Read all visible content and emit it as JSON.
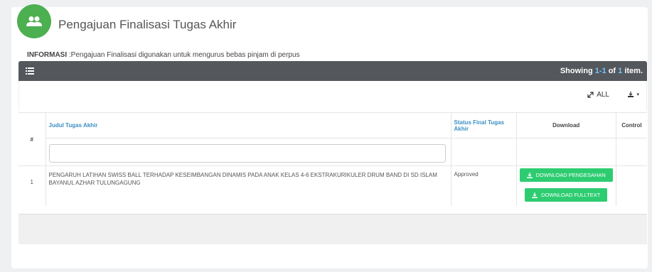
{
  "header": {
    "title": "Pengajuan Finalisasi Tugas Akhir",
    "icon": "users-icon"
  },
  "info": {
    "label": "INFORMASI",
    "text": " :Pengajuan Finalisasi digunakan untuk mengurus bebas pinjam di perpus"
  },
  "toolbar": {
    "showing_prefix": "Showing ",
    "range": "1-1",
    "of": " of ",
    "total": "1",
    "suffix": " item."
  },
  "subbar": {
    "all_label": "ALL"
  },
  "table": {
    "headers": {
      "num": "#",
      "judul": "Judul Tugas Akhir",
      "status": "Status Final Tugas Akhir",
      "download": "Download",
      "control": "Control"
    },
    "rows": [
      {
        "num": "1",
        "judul": "PENGARUH LATIHAN SWISS BALL TERHADAP KESEIMBANGAN DINAMIS PADA ANAK KELAS 4-6 EKSTRAKURIKULER DRUM BAND DI SD ISLAM BAYANUL AZHAR TULUNGAGUNG",
        "status": "Approved",
        "btn_pengesahan": "DOWNLOAD PENGESAHAN",
        "btn_fulltext": "DOWNLOAD FULLTEXT"
      }
    ]
  },
  "colors": {
    "accent": "#4caf50",
    "button": "#2ecc71",
    "toolbar": "#54575c",
    "link": "#3a8fc4"
  }
}
